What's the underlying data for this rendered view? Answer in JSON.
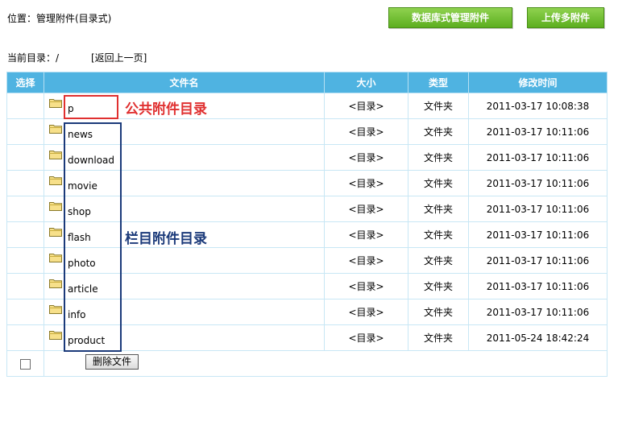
{
  "header": {
    "location": "位置：管理附件(目录式)",
    "btn_db": "数据库式管理附件",
    "btn_upload": "上传多附件"
  },
  "curdir": {
    "label": "当前目录：/",
    "back": "[返回上一页]"
  },
  "table": {
    "headers": [
      "选择",
      "文件名",
      "大小",
      "类型",
      "修改时间"
    ],
    "rows": [
      {
        "name": "p",
        "size": "<目录>",
        "type": "文件夹",
        "time": "2011-03-17 10:08:38"
      },
      {
        "name": "news",
        "size": "<目录>",
        "type": "文件夹",
        "time": "2011-03-17 10:11:06"
      },
      {
        "name": "download",
        "size": "<目录>",
        "type": "文件夹",
        "time": "2011-03-17 10:11:06"
      },
      {
        "name": "movie",
        "size": "<目录>",
        "type": "文件夹",
        "time": "2011-03-17 10:11:06"
      },
      {
        "name": "shop",
        "size": "<目录>",
        "type": "文件夹",
        "time": "2011-03-17 10:11:06"
      },
      {
        "name": "flash",
        "size": "<目录>",
        "type": "文件夹",
        "time": "2011-03-17 10:11:06"
      },
      {
        "name": "photo",
        "size": "<目录>",
        "type": "文件夹",
        "time": "2011-03-17 10:11:06"
      },
      {
        "name": "article",
        "size": "<目录>",
        "type": "文件夹",
        "time": "2011-03-17 10:11:06"
      },
      {
        "name": "info",
        "size": "<目录>",
        "type": "文件夹",
        "time": "2011-03-17 10:11:06"
      },
      {
        "name": "product",
        "size": "<目录>",
        "type": "文件夹",
        "time": "2011-05-24 18:42:24"
      }
    ],
    "delete_label": "删除文件"
  },
  "annotations": {
    "public": "公共附件目录",
    "column": "栏目附件目录"
  },
  "colors": {
    "header_bg": "#4fb3e1",
    "button_green": "#6cbd2a",
    "annotation_red": "#e03030",
    "annotation_blue": "#1b3a7a"
  }
}
